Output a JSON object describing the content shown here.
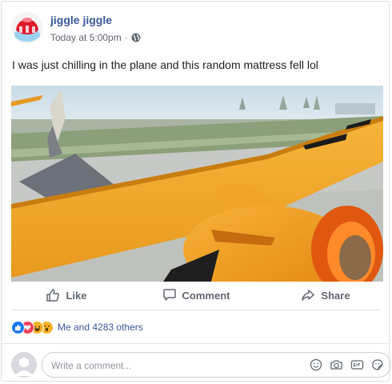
{
  "post": {
    "author": "jiggle jiggle",
    "timestamp": "Today at 5:00pm",
    "separator": "·",
    "privacy_icon": "globe-icon",
    "text": "I was just chilling in the plane and this random mattress fell lol"
  },
  "actions": {
    "like": "Like",
    "comment": "Comment",
    "share": "Share"
  },
  "reactions": {
    "icons": [
      "like-icon",
      "love-icon",
      "haha-icon",
      "wow-icon"
    ],
    "summary": "Me and 4283 others"
  },
  "comment_box": {
    "placeholder": "Write a comment...",
    "icons": [
      "emoji-icon",
      "camera-icon",
      "gif-icon",
      "sticker-icon"
    ]
  },
  "colors": {
    "link": "#385898",
    "muted": "#606770",
    "like_blue": "#1877f2",
    "love_red": "#f33e58",
    "haha_yellow": "#f7b125",
    "wing_yellow": "#f2a72a"
  }
}
